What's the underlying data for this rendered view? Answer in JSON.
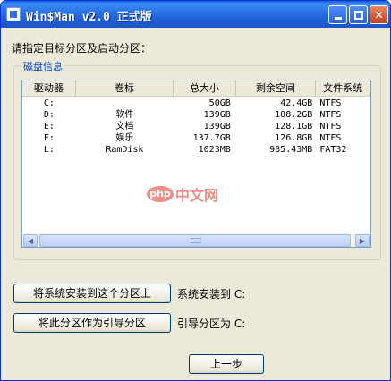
{
  "window": {
    "title": "Win$Man v2.0 正式版",
    "title_bar_color": "#1f5fd6",
    "close_color": "#c4401c"
  },
  "prompt": "请指定目标分区及启动分区：",
  "disk_info": {
    "legend": "磁盘信息",
    "legend_color": "#0046d5",
    "columns": [
      "驱动器",
      "卷标",
      "总大小",
      "剩余空间",
      "文件系统"
    ],
    "rows": [
      [
        "C:",
        "",
        "50GB",
        "42.4GB",
        "NTFS"
      ],
      [
        "D:",
        "软件",
        "139GB",
        "108.2GB",
        "NTFS"
      ],
      [
        "E:",
        "文档",
        "139GB",
        "128.1GB",
        "NTFS"
      ],
      [
        "F:",
        "娱乐",
        "137.7GB",
        "126.8GB",
        "NTFS"
      ],
      [
        "L:",
        "RamDisk",
        "1023MB",
        "985.43MB",
        "FAT32"
      ]
    ]
  },
  "actions": {
    "install_button": "将系统安装到这个分区上",
    "install_label": "系统安装到  C:",
    "boot_button": "将此分区作为引导分区",
    "boot_label": "引导分区为  C:",
    "prev_button": "上一步"
  },
  "watermark": {
    "badge": "php",
    "site": "中文网"
  }
}
